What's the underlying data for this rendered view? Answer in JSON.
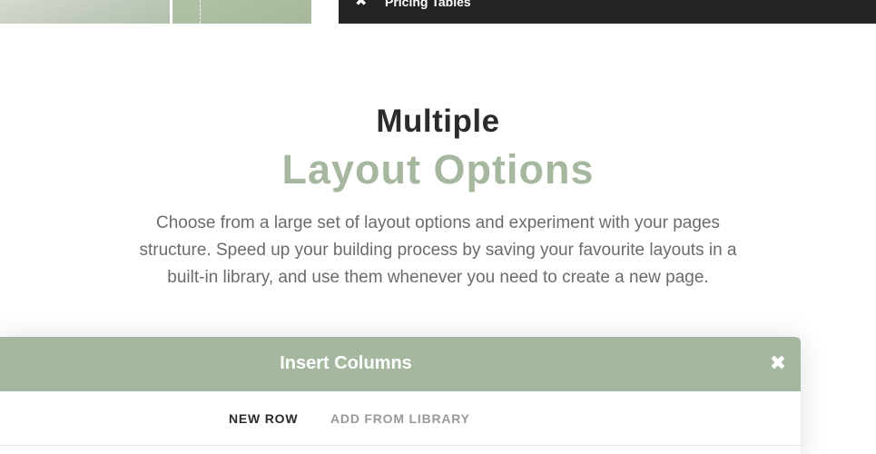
{
  "top_bar": {
    "close_icon_glyph": "✖",
    "label": "Pricing Tables"
  },
  "hero": {
    "heading_line1": "Multiple",
    "heading_line2": "Layout Options",
    "description": "Choose from a large set of layout options and experiment with your pages structure. Speed up your building process by saving your favourite layouts in a built-in library, and use them whenever you need to create a new page."
  },
  "modal": {
    "title": "Insert Columns",
    "close_icon_glyph": "✖",
    "tabs": [
      {
        "label": "NEW ROW",
        "active": true
      },
      {
        "label": "ADD FROM LIBRARY",
        "active": false
      }
    ]
  },
  "colors": {
    "accent": "#a5b79e",
    "dark": "#232323",
    "heading": "#2b2b2b",
    "body_text": "#6b6b6b",
    "inactive_tab": "#999999"
  },
  "icons": {
    "bar_close": "close-icon",
    "modal_close": "close-icon"
  }
}
